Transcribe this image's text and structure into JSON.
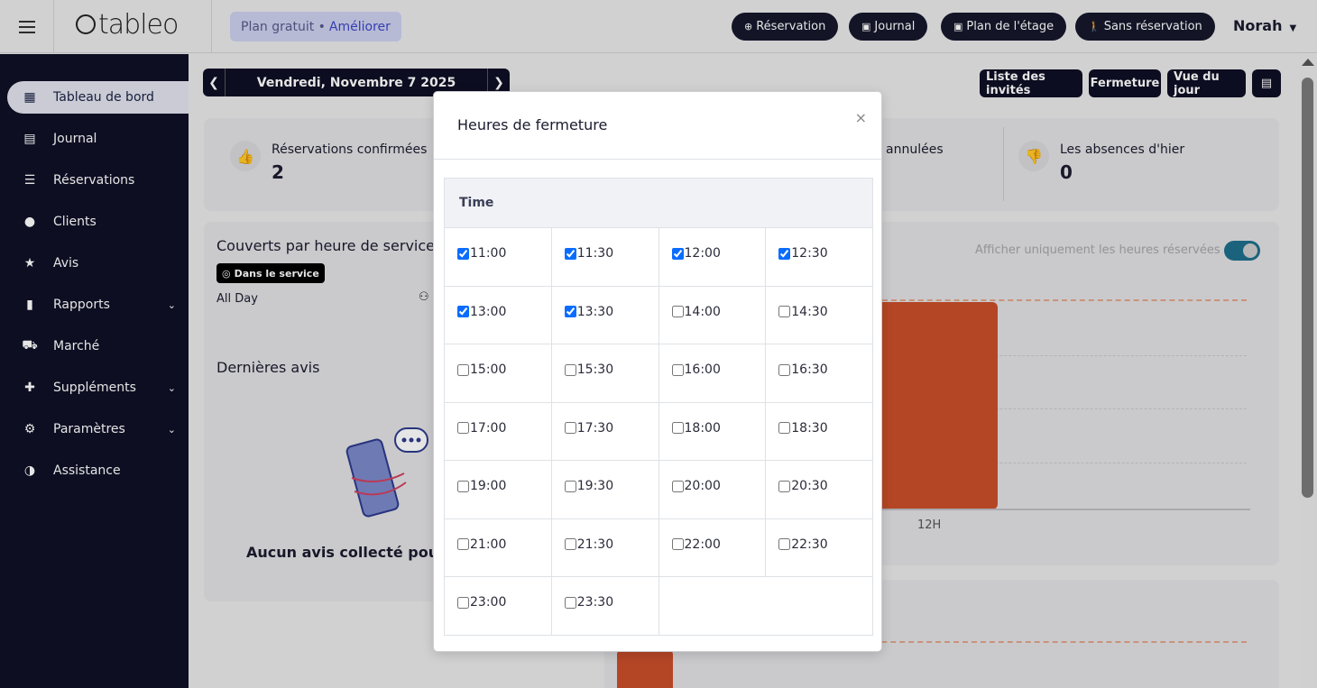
{
  "topbar": {
    "logo": "tableo",
    "plan_label": "Plan gratuit •",
    "plan_upgrade": "Améliorer",
    "buttons": [
      {
        "icon": "⊕",
        "label": "Réservation"
      },
      {
        "icon": "▣",
        "label": "Journal"
      },
      {
        "icon": "▣",
        "label": "Plan de l'étage"
      },
      {
        "icon": "🚶",
        "label": "Sans réservation"
      }
    ],
    "user": "Norah"
  },
  "sidebar": {
    "items": [
      {
        "icon": "▦",
        "label": "Tableau de bord"
      },
      {
        "icon": "▤",
        "label": "Journal"
      },
      {
        "icon": "☰",
        "label": "Réservations"
      },
      {
        "icon": "●",
        "label": "Clients"
      },
      {
        "icon": "★",
        "label": "Avis"
      },
      {
        "icon": "▮",
        "label": "Rapports"
      },
      {
        "icon": "⛟",
        "label": "Marché"
      },
      {
        "icon": "✚",
        "label": "Suppléments"
      },
      {
        "icon": "⚙",
        "label": "Paramètres"
      },
      {
        "icon": "◑",
        "label": "Assistance"
      }
    ]
  },
  "main": {
    "date": "Vendredi, Novembre 7 2025",
    "actions": [
      "Liste des invités",
      "Fermeture",
      "Vue du jour"
    ],
    "stats": {
      "confirmed_label": "Réservations confirmées",
      "confirmed_value": "2",
      "cancelled_label": "annulées",
      "noshow_label": "Les absences d'hier",
      "noshow_value": "0"
    },
    "covers": {
      "title": "Couverts par heure de service",
      "badge": "Dans le service",
      "period": "All Day",
      "toggle_label": "Afficher uniquement les heures réservées",
      "bar_label": "12H"
    },
    "reviews": {
      "title": "Dernières avis",
      "empty": "Aucun avis collecté pour"
    }
  },
  "modal": {
    "title": "Heures de fermeture",
    "close": "×",
    "column_header": "Time",
    "hours": [
      {
        "time": "11:00",
        "checked": true
      },
      {
        "time": "11:30",
        "checked": true
      },
      {
        "time": "12:00",
        "checked": true
      },
      {
        "time": "12:30",
        "checked": true
      },
      {
        "time": "13:00",
        "checked": true
      },
      {
        "time": "13:30",
        "checked": true
      },
      {
        "time": "14:00",
        "checked": false
      },
      {
        "time": "14:30",
        "checked": false
      },
      {
        "time": "15:00",
        "checked": false
      },
      {
        "time": "15:30",
        "checked": false
      },
      {
        "time": "16:00",
        "checked": false
      },
      {
        "time": "16:30",
        "checked": false
      },
      {
        "time": "17:00",
        "checked": false
      },
      {
        "time": "17:30",
        "checked": false
      },
      {
        "time": "18:00",
        "checked": false
      },
      {
        "time": "18:30",
        "checked": false
      },
      {
        "time": "19:00",
        "checked": false
      },
      {
        "time": "19:30",
        "checked": false
      },
      {
        "time": "20:00",
        "checked": false
      },
      {
        "time": "20:30",
        "checked": false
      },
      {
        "time": "21:00",
        "checked": false
      },
      {
        "time": "21:30",
        "checked": false
      },
      {
        "time": "22:00",
        "checked": false
      },
      {
        "time": "22:30",
        "checked": false
      },
      {
        "time": "23:00",
        "checked": false
      },
      {
        "time": "23:30",
        "checked": false
      }
    ]
  },
  "colors": {
    "sidebar_bg": "#0f1026",
    "accent_bar": "#c94f2a",
    "checkbox": "#0a6cff"
  }
}
